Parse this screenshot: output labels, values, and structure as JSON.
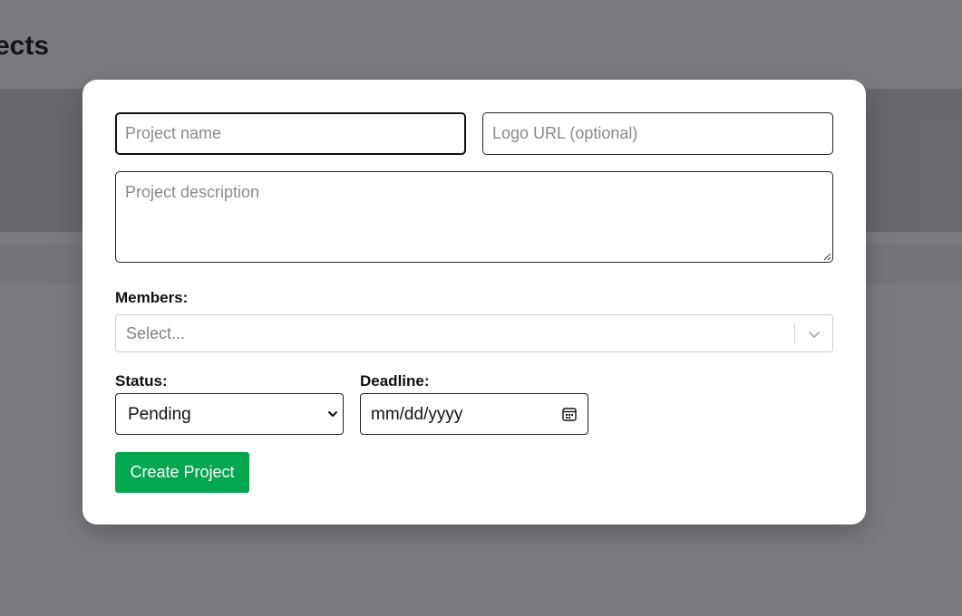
{
  "background": {
    "page_title": "ects"
  },
  "form": {
    "name_placeholder": "Project name",
    "logo_placeholder": "Logo URL (optional)",
    "description_placeholder": "Project description",
    "members_label": "Members:",
    "members_placeholder": "Select...",
    "status_label": "Status:",
    "status_value": "Pending",
    "deadline_label": "Deadline:",
    "deadline_placeholder": "mm/dd/yyyy",
    "submit_label": "Create Project"
  },
  "icons": {
    "members_dropdown": "chevron-down-icon",
    "status_dropdown": "chevron-down-icon",
    "deadline_picker": "calendar-icon"
  },
  "colors": {
    "primary_button": "#03a84e",
    "overlay": "rgba(24,26,30,0.55)"
  }
}
